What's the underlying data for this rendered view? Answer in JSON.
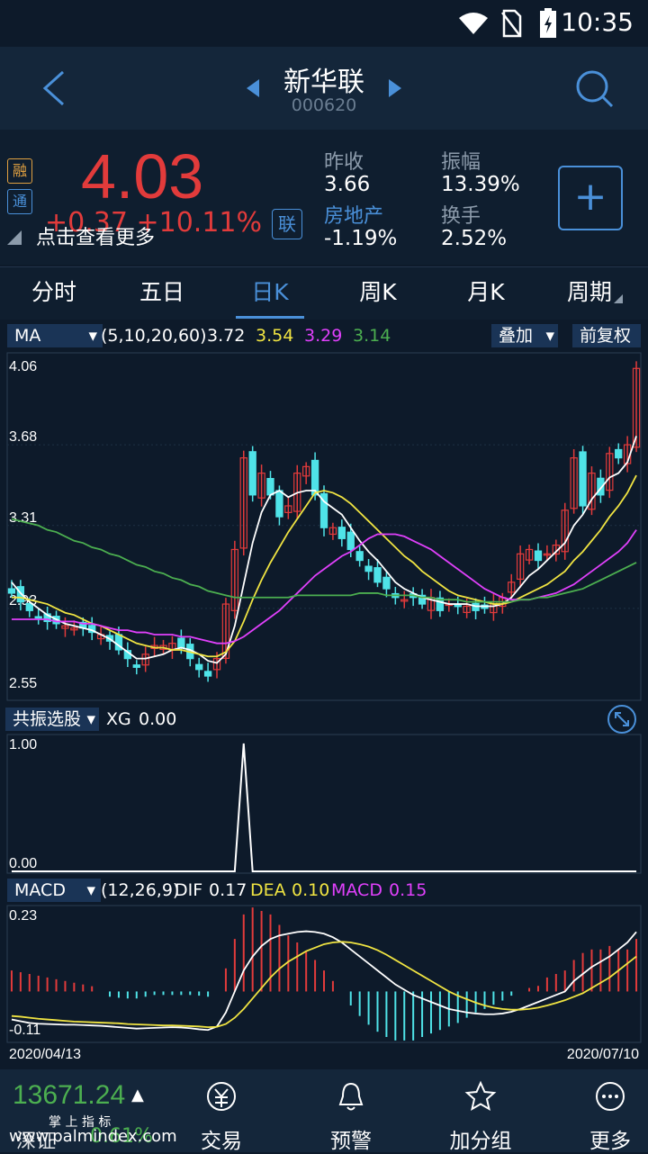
{
  "status": {
    "time": "10:35"
  },
  "header": {
    "title": "新华联",
    "code": "000620"
  },
  "quote": {
    "tag_rong": "融",
    "tag_tong": "通",
    "price": "4.03",
    "change": "+0.37  +10.11%",
    "hint": "点击查看更多",
    "lian": "联",
    "prev_close_label": "昨收",
    "prev_close": "3.66",
    "sector_label": "房地产",
    "sector_change": "-1.19%",
    "amplitude_label": "振幅",
    "amplitude": "13.39%",
    "turnover_label": "换手",
    "turnover": "2.52%",
    "colors": {
      "up": "#e23b3b",
      "down": "#4fe3e8",
      "accent": "#4a90d9"
    }
  },
  "tabs": [
    {
      "label": "分时"
    },
    {
      "label": "五日"
    },
    {
      "label": "日K"
    },
    {
      "label": "周K"
    },
    {
      "label": "月K"
    },
    {
      "label": "周期"
    }
  ],
  "ma_bar": {
    "dropdown": "MA",
    "params": "(5,10,20,60)",
    "v1": "3.72",
    "v2": "3.54",
    "v3": "3.29",
    "v4": "3.14",
    "overlay": "叠加",
    "adjust": "前复权"
  },
  "xg_bar": {
    "dropdown": "共振选股",
    "label": "XG",
    "value": "0.00"
  },
  "macd_bar": {
    "dropdown": "MACD",
    "params": "(12,26,9)",
    "dif_label": "DIF",
    "dif": "0.17",
    "dea_label": "DEA",
    "dea": "0.10",
    "macd_label": "MACD",
    "macd": "0.15"
  },
  "chart_data": [
    {
      "type": "candlestick",
      "y_ticks": [
        "4.06",
        "3.68",
        "3.31",
        "2.93",
        "2.55"
      ],
      "ylim": [
        2.55,
        4.06
      ],
      "x_range": [
        "2020/04/13",
        "2020/07/10"
      ],
      "close": [
        3.0,
        2.96,
        2.92,
        2.89,
        2.87,
        2.86,
        2.85,
        2.84,
        2.84,
        2.82,
        2.81,
        2.78,
        2.74,
        2.7,
        2.66,
        2.72,
        2.76,
        2.76,
        2.77,
        2.75,
        2.7,
        2.65,
        2.62,
        2.7,
        2.95,
        3.2,
        3.62,
        3.45,
        3.55,
        3.45,
        3.35,
        3.4,
        3.55,
        3.58,
        3.45,
        3.3,
        3.3,
        3.25,
        3.2,
        3.15,
        3.1,
        3.05,
        3.02,
        2.98,
        2.97,
        2.98,
        2.95,
        2.98,
        2.92,
        2.95,
        2.94,
        2.94,
        2.92,
        2.93,
        2.96,
        2.98,
        3.05,
        3.18,
        3.2,
        3.15,
        3.18,
        3.22,
        3.38,
        3.62,
        3.4,
        3.55,
        3.45,
        3.64,
        3.62,
        3.68,
        4.03
      ],
      "ma_series": [
        {
          "name": "MA5",
          "color": "#ffffff",
          "values": [
            3.05,
            3.0,
            2.96,
            2.93,
            2.9,
            2.88,
            2.86,
            2.85,
            2.84,
            2.83,
            2.81,
            2.79,
            2.76,
            2.73,
            2.7,
            2.7,
            2.71,
            2.72,
            2.74,
            2.75,
            2.74,
            2.72,
            2.69,
            2.68,
            2.72,
            2.85,
            3.04,
            3.23,
            3.37,
            3.45,
            3.47,
            3.44,
            3.46,
            3.47,
            3.47,
            3.42,
            3.39,
            3.36,
            3.3,
            3.24,
            3.19,
            3.15,
            3.1,
            3.05,
            3.02,
            3.0,
            2.98,
            2.97,
            2.96,
            2.95,
            2.95,
            2.95,
            2.94,
            2.94,
            2.94,
            2.95,
            2.98,
            3.03,
            3.08,
            3.11,
            3.15,
            3.19,
            3.23,
            3.31,
            3.36,
            3.43,
            3.48,
            3.53,
            3.55,
            3.6,
            3.72
          ]
        },
        {
          "name": "MA10",
          "color": "#f0e442",
          "values": [
            2.98,
            2.98,
            2.97,
            2.96,
            2.95,
            2.93,
            2.91,
            2.9,
            2.88,
            2.86,
            2.85,
            2.83,
            2.81,
            2.79,
            2.77,
            2.76,
            2.75,
            2.75,
            2.74,
            2.74,
            2.73,
            2.72,
            2.71,
            2.71,
            2.73,
            2.78,
            2.87,
            2.97,
            3.06,
            3.14,
            3.21,
            3.28,
            3.34,
            3.4,
            3.46,
            3.47,
            3.46,
            3.44,
            3.41,
            3.37,
            3.33,
            3.29,
            3.25,
            3.21,
            3.17,
            3.14,
            3.1,
            3.07,
            3.04,
            3.01,
            2.99,
            2.98,
            2.97,
            2.96,
            2.95,
            2.95,
            2.96,
            2.98,
            3.0,
            3.02,
            3.04,
            3.07,
            3.1,
            3.15,
            3.19,
            3.24,
            3.29,
            3.35,
            3.4,
            3.46,
            3.54
          ]
        },
        {
          "name": "MA20",
          "color": "#e040fb",
          "values": [
            2.88,
            2.88,
            2.88,
            2.88,
            2.88,
            2.87,
            2.87,
            2.87,
            2.86,
            2.86,
            2.85,
            2.84,
            2.83,
            2.83,
            2.82,
            2.82,
            2.81,
            2.81,
            2.81,
            2.8,
            2.8,
            2.79,
            2.78,
            2.77,
            2.77,
            2.78,
            2.8,
            2.83,
            2.86,
            2.89,
            2.92,
            2.96,
            3.0,
            3.04,
            3.08,
            3.11,
            3.14,
            3.17,
            3.19,
            3.22,
            3.25,
            3.27,
            3.27,
            3.27,
            3.26,
            3.24,
            3.22,
            3.2,
            3.17,
            3.14,
            3.11,
            3.08,
            3.05,
            3.02,
            3.0,
            2.98,
            2.97,
            2.97,
            2.97,
            2.98,
            2.99,
            3.0,
            3.02,
            3.04,
            3.07,
            3.1,
            3.13,
            3.16,
            3.19,
            3.23,
            3.29
          ]
        },
        {
          "name": "MA60",
          "color": "#4caf50",
          "values": [
            3.34,
            3.33,
            3.32,
            3.31,
            3.29,
            3.28,
            3.26,
            3.24,
            3.23,
            3.21,
            3.2,
            3.18,
            3.17,
            3.15,
            3.13,
            3.12,
            3.1,
            3.09,
            3.07,
            3.06,
            3.04,
            3.03,
            3.01,
            3.0,
            2.99,
            2.98,
            2.98,
            2.98,
            2.98,
            2.98,
            2.98,
            2.98,
            2.99,
            2.99,
            2.99,
            2.99,
            2.99,
            2.99,
            2.99,
            3.0,
            3.0,
            3.0,
            2.99,
            2.99,
            2.99,
            2.99,
            2.98,
            2.98,
            2.97,
            2.97,
            2.97,
            2.96,
            2.96,
            2.96,
            2.96,
            2.96,
            2.96,
            2.97,
            2.97,
            2.98,
            2.98,
            2.99,
            3.0,
            3.01,
            3.02,
            3.04,
            3.06,
            3.08,
            3.1,
            3.12,
            3.14
          ]
        }
      ]
    },
    {
      "type": "line",
      "name": "XG",
      "y_ticks": [
        "1.00",
        "0.00"
      ],
      "ylim": [
        0,
        1
      ],
      "values": [
        0,
        0,
        0,
        0,
        0,
        0,
        0,
        0,
        0,
        0,
        0,
        0,
        0,
        0,
        0,
        0,
        0,
        0,
        0,
        0,
        0,
        0,
        0,
        0,
        0,
        0,
        1,
        0,
        0,
        0,
        0,
        0,
        0,
        0,
        0,
        0,
        0,
        0,
        0,
        0,
        0,
        0,
        0,
        0,
        0,
        0,
        0,
        0,
        0,
        0,
        0,
        0,
        0,
        0,
        0,
        0,
        0,
        0,
        0,
        0,
        0,
        0,
        0,
        0,
        0,
        0,
        0,
        0,
        0,
        0,
        0
      ]
    },
    {
      "type": "macd",
      "y_ticks": [
        "0.23",
        "-0.11"
      ],
      "ylim": [
        -0.13,
        0.23
      ],
      "x_labels": [
        "2020/04/13",
        "2020/07/10"
      ],
      "dif": [
        -0.08,
        -0.085,
        -0.09,
        -0.092,
        -0.093,
        -0.094,
        -0.095,
        -0.095,
        -0.096,
        -0.097,
        -0.098,
        -0.1,
        -0.102,
        -0.104,
        -0.106,
        -0.105,
        -0.104,
        -0.103,
        -0.102,
        -0.103,
        -0.105,
        -0.108,
        -0.11,
        -0.1,
        -0.06,
        0.0,
        0.06,
        0.1,
        0.13,
        0.15,
        0.16,
        0.165,
        0.17,
        0.172,
        0.17,
        0.165,
        0.155,
        0.14,
        0.12,
        0.1,
        0.08,
        0.06,
        0.04,
        0.02,
        0.005,
        -0.01,
        -0.02,
        -0.03,
        -0.04,
        -0.05,
        -0.055,
        -0.06,
        -0.063,
        -0.065,
        -0.065,
        -0.063,
        -0.058,
        -0.05,
        -0.04,
        -0.03,
        -0.02,
        -0.01,
        0.0,
        0.03,
        0.05,
        0.07,
        0.085,
        0.1,
        0.12,
        0.14,
        0.17
      ],
      "dea": [
        -0.07,
        -0.072,
        -0.075,
        -0.078,
        -0.08,
        -0.082,
        -0.084,
        -0.086,
        -0.087,
        -0.088,
        -0.089,
        -0.09,
        -0.091,
        -0.093,
        -0.094,
        -0.095,
        -0.096,
        -0.097,
        -0.097,
        -0.098,
        -0.099,
        -0.1,
        -0.102,
        -0.101,
        -0.093,
        -0.075,
        -0.05,
        -0.02,
        0.01,
        0.04,
        0.065,
        0.085,
        0.1,
        0.115,
        0.125,
        0.135,
        0.14,
        0.142,
        0.14,
        0.135,
        0.128,
        0.118,
        0.105,
        0.09,
        0.075,
        0.06,
        0.045,
        0.03,
        0.015,
        0.0,
        -0.012,
        -0.022,
        -0.032,
        -0.04,
        -0.046,
        -0.05,
        -0.052,
        -0.052,
        -0.05,
        -0.046,
        -0.04,
        -0.033,
        -0.025,
        -0.015,
        -0.005,
        0.01,
        0.025,
        0.04,
        0.06,
        0.08,
        0.1
      ],
      "macd": [
        0.06,
        0.055,
        0.05,
        0.045,
        0.04,
        0.035,
        0.03,
        0.025,
        0.02,
        0.015,
        0.0,
        -0.015,
        -0.018,
        -0.02,
        -0.02,
        -0.015,
        -0.01,
        -0.01,
        -0.01,
        -0.01,
        -0.01,
        -0.012,
        -0.015,
        0.0,
        0.066,
        0.15,
        0.22,
        0.24,
        0.23,
        0.22,
        0.19,
        0.16,
        0.14,
        0.115,
        0.09,
        0.06,
        0.03,
        0.0,
        -0.04,
        -0.07,
        -0.095,
        -0.115,
        -0.13,
        -0.14,
        -0.14,
        -0.14,
        -0.13,
        -0.12,
        -0.11,
        -0.1,
        -0.09,
        -0.075,
        -0.06,
        -0.05,
        -0.038,
        -0.026,
        -0.012,
        0.0,
        0.01,
        0.016,
        0.04,
        0.05,
        0.06,
        0.09,
        0.11,
        0.12,
        0.12,
        0.13,
        0.12,
        0.12,
        0.15
      ]
    }
  ],
  "bottom": {
    "index_value": "13671.24",
    "index_arrow": "▲",
    "index_name": "深证",
    "index_change": "0.61%",
    "index_sub": "掌 上 指 标",
    "watermark": "www.palmindex.com",
    "items": [
      {
        "label": "交易",
        "icon": "trade-icon"
      },
      {
        "label": "预警",
        "icon": "bell-icon"
      },
      {
        "label": "加分组",
        "icon": "star-icon"
      },
      {
        "label": "更多",
        "icon": "more-icon"
      }
    ]
  }
}
